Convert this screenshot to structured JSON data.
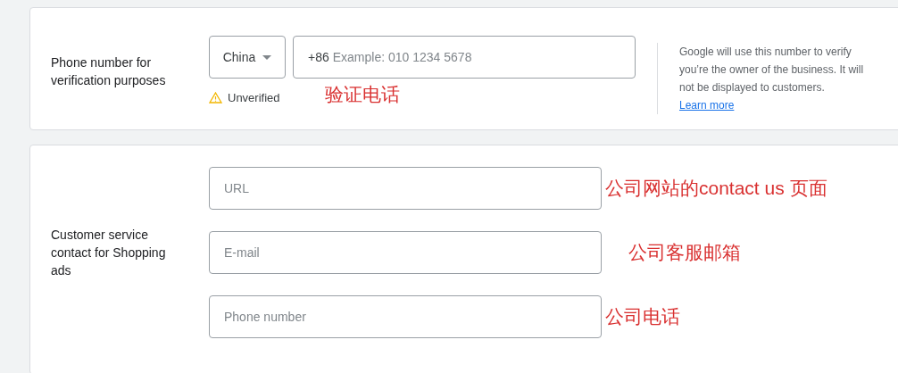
{
  "verification": {
    "label": "Phone number for verification purposes",
    "country": "China",
    "country_code": "+86",
    "placeholder": "Example: 010 1234 5678",
    "status": "Unverified",
    "note": "验证电话",
    "help": "Google will use this number to verify you’re the owner of the business. It will not be displayed to customers.",
    "help_link": "Learn more"
  },
  "customer_service": {
    "label": "Customer service contact for Shopping ads",
    "fields": [
      {
        "placeholder": "URL",
        "note": "公司网站的contact us 页面"
      },
      {
        "placeholder": "E-mail",
        "note": "公司客服邮箱"
      },
      {
        "placeholder": "Phone number",
        "note": "公司电话"
      }
    ]
  }
}
